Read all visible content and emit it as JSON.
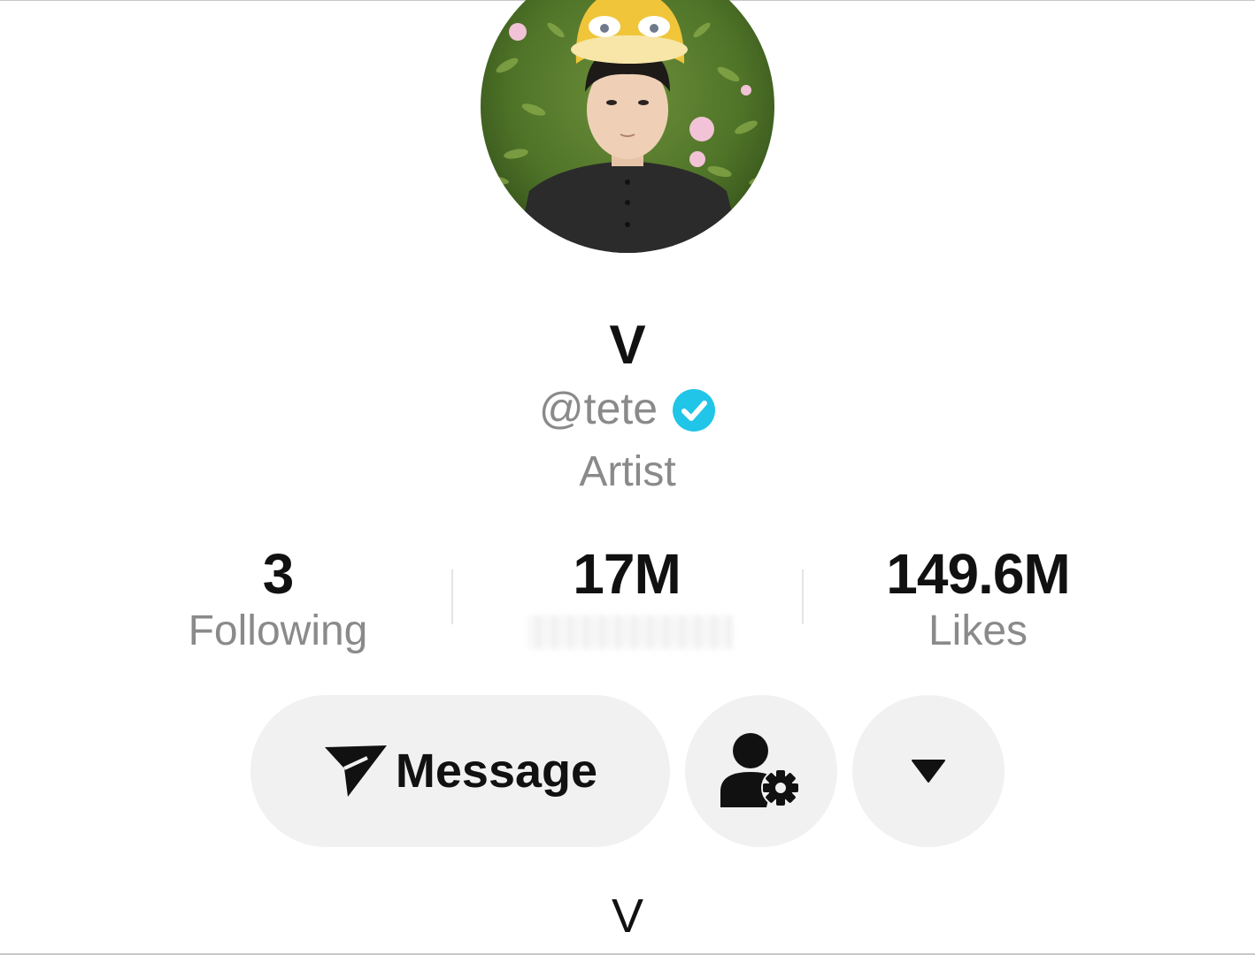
{
  "profile": {
    "display_name": "V",
    "handle": "@tete",
    "verified": true,
    "bio": "Artist"
  },
  "stats": {
    "following": {
      "value": "3",
      "label": "Following"
    },
    "followers": {
      "value": "17M"
    },
    "likes": {
      "value": "149.6M",
      "label": "Likes"
    }
  },
  "actions": {
    "message_label": "Message",
    "add_friend_icon": "person-gear-icon",
    "more_icon": "caret-down-icon"
  },
  "footer": {
    "text": "V"
  },
  "colors": {
    "verified_badge": "#20c5e8",
    "button_bg": "#f1f1f1",
    "secondary_text": "#8a8a8a",
    "primary_text": "#111111"
  }
}
